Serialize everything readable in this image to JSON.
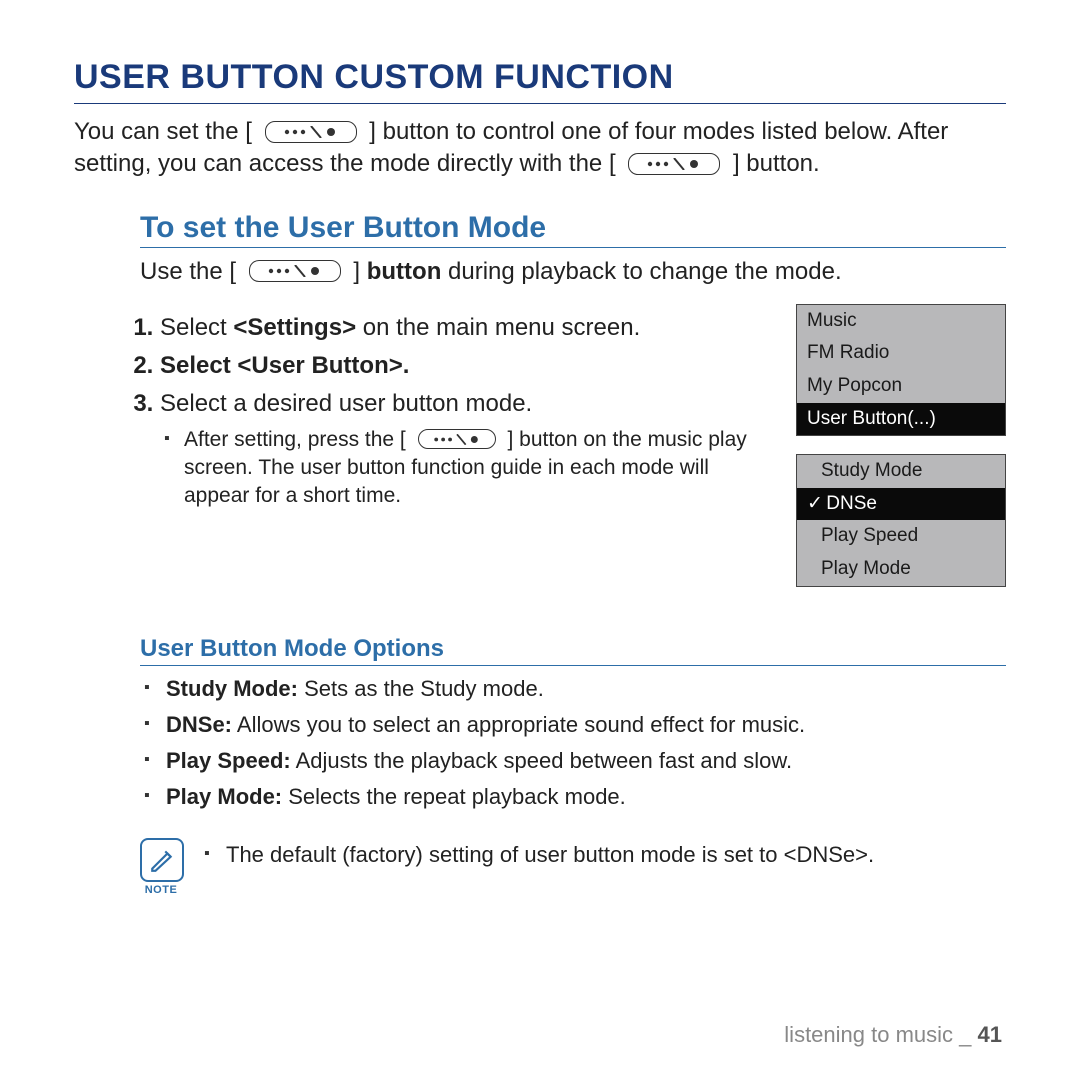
{
  "title": "USER BUTTON CUSTOM FUNCTION",
  "intro": {
    "part1": "You can set the [",
    "part2": "] button to control one of four modes listed below. After setting, you can access the mode directly with the [",
    "part3": "] button."
  },
  "section": {
    "heading": "To set the User Button Mode",
    "use_text": {
      "pre": "Use the [",
      "mid": "] ",
      "bold": "button",
      "post": " during playback to change the mode."
    },
    "steps": [
      {
        "pre": "Select ",
        "bold": "<Settings>",
        "post": " on the main menu screen."
      },
      {
        "pre": "Select ",
        "bold": "<User Button>",
        "post": ".",
        "allbold": true
      },
      {
        "pre": "Select a desired user button mode.",
        "bold": "",
        "post": ""
      }
    ],
    "substep": {
      "pre": "After setting, press the [",
      "post": "] button on the music play screen. The user button function guide in each mode will appear for a short time."
    }
  },
  "screens": {
    "menu1": [
      {
        "label": "Music",
        "selected": false
      },
      {
        "label": "FM Radio",
        "selected": false
      },
      {
        "label": "My Popcon",
        "selected": false
      },
      {
        "label": "User Button(...)",
        "selected": true
      }
    ],
    "menu2": [
      {
        "label": "Study Mode",
        "selected": false,
        "check": false
      },
      {
        "label": "DNSe",
        "selected": true,
        "check": true
      },
      {
        "label": "Play Speed",
        "selected": false,
        "check": false
      },
      {
        "label": "Play Mode",
        "selected": false,
        "check": false
      }
    ]
  },
  "options": {
    "heading": "User Button Mode Options",
    "items": [
      {
        "bold": "Study Mode:",
        "desc": " Sets as the Study mode."
      },
      {
        "bold": "DNSe:",
        "desc": " Allows you to select an appropriate sound effect for music."
      },
      {
        "bold": "Play Speed:",
        "desc": " Adjusts the playback speed between fast and slow."
      },
      {
        "bold": "Play Mode:",
        "desc": " Selects the repeat playback mode."
      }
    ]
  },
  "note": {
    "label": "NOTE",
    "text": "The default (factory) setting of user button mode is set to <DNSe>."
  },
  "footer": {
    "section": "listening to music _",
    "page": "41"
  }
}
